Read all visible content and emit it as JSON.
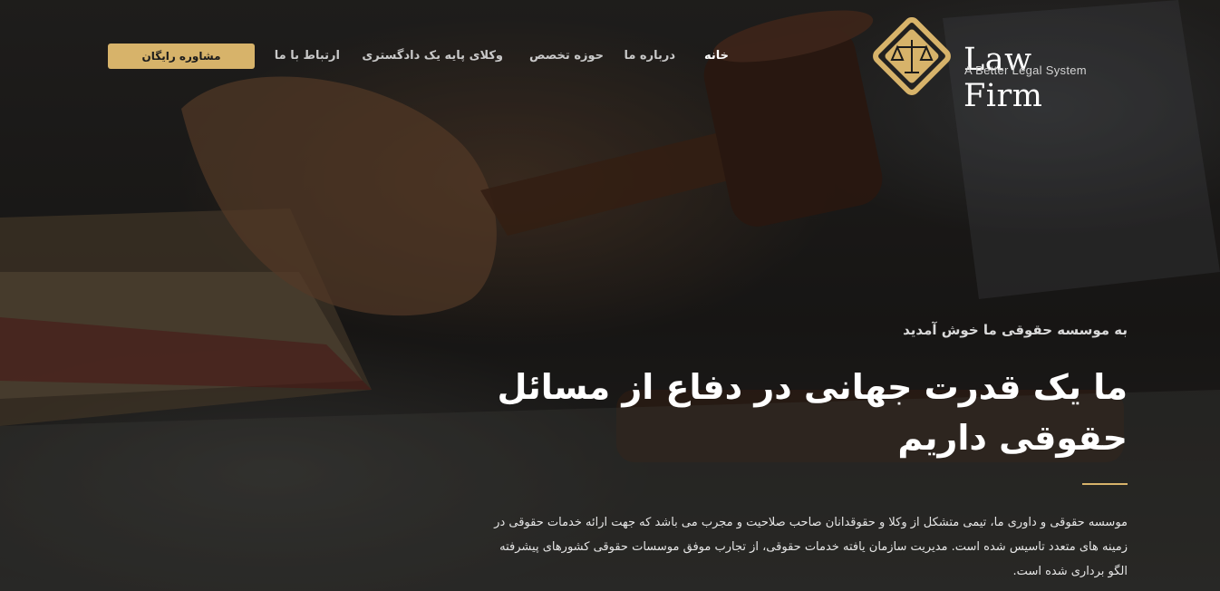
{
  "brand": {
    "title": "Law Firm",
    "tagline": "A Better Legal System",
    "accent": "#d7b36a"
  },
  "nav": {
    "items": [
      {
        "label": "خانه",
        "active": true
      },
      {
        "label": "درباره ما",
        "active": false
      },
      {
        "label": "حوزه تخصص",
        "active": false
      },
      {
        "label": "وکلای پایه یک دادگستری",
        "active": false
      },
      {
        "label": "ارتباط با ما",
        "active": false
      }
    ],
    "cta_label": "مشاوره رایگان"
  },
  "hero": {
    "eyebrow": "به موسسه حقوقی ما خوش آمدید",
    "headline_line1": "ما یک قدرت جهانی در دفاع از مسائل",
    "headline_line2": "حقوقی داریم",
    "body": "موسسه حقوقی و داوری ما، تیمی متشکل از وکلا و حقوقدانان صاحب صلاحیت و مجرب می باشد که جهت ارائه خدمات حقوقی در زمینه های متعدد تاسیس شده است. مدیریت سازمان یافته خدمات حقوقی، از تجارب موفق موسسات حقوقی کشورهای پیشرفته الگو برداری شده است.",
    "background_image": "gavel-icon"
  }
}
